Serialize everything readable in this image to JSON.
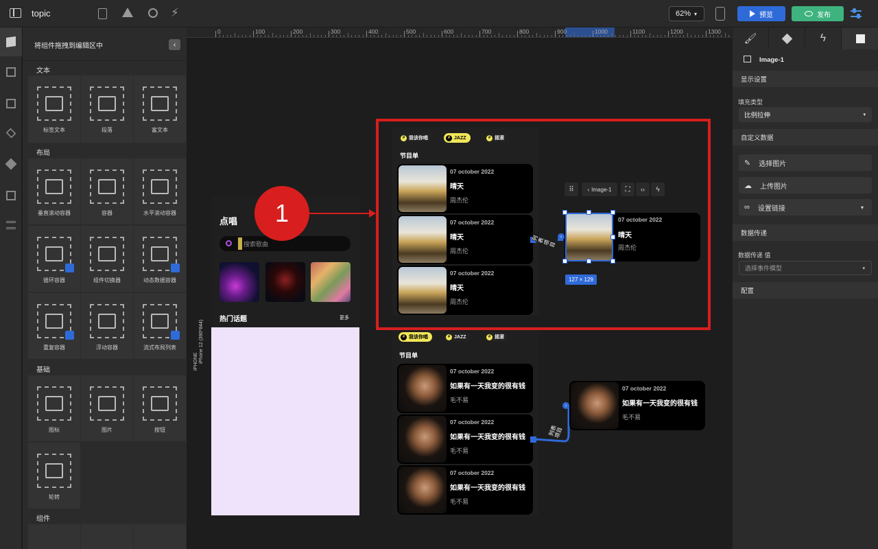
{
  "app": {
    "title": "topic"
  },
  "toolbar": {
    "zoom": "62%",
    "preview": "预览",
    "publish": "发布"
  },
  "library": {
    "header": "将组件拖拽到编辑区中",
    "sections": {
      "text": "文本",
      "layout": "布局",
      "basic": "基础",
      "components": "组件"
    },
    "text_items": [
      "标签文本",
      "段落",
      "富文本"
    ],
    "layout_items": [
      "垂直滚动容器",
      "容器",
      "水平滚动容器",
      "循环容器",
      "组件切换器",
      "动态数据容器",
      "重复容器",
      "浮动容器",
      "流式布局列表"
    ],
    "basic_items": [
      "图标",
      "图片",
      "按钮",
      "轮转"
    ]
  },
  "ruler": {
    "ticks": [
      "0",
      "100",
      "200",
      "300",
      "400",
      "500",
      "600",
      "700",
      "800",
      "900",
      "1000",
      "1100",
      "1200",
      "1300"
    ]
  },
  "phone": {
    "label": "iPHONE",
    "device": "iPhone 12 (390*844)",
    "title": "点唱",
    "search_placeholder": "搜索歌曲",
    "section_title": "热门话题",
    "more": "更多"
  },
  "annotation": {
    "number": "1"
  },
  "list_a": {
    "chips": [
      "我该你唱",
      "JAZZ",
      "摇滚"
    ],
    "active_chip": 1,
    "heading": "节目单",
    "cards": [
      {
        "date": "07 october 2022",
        "title": "晴天",
        "artist": "周杰伦"
      },
      {
        "date": "07 october 2022",
        "title": "晴天",
        "artist": "周杰伦"
      },
      {
        "date": "07 october 2022",
        "title": "晴天",
        "artist": "周杰伦"
      }
    ],
    "detail": {
      "date": "07 october 2022",
      "title": "晴天",
      "artist": "周杰伦"
    },
    "connector_label": "列表项目"
  },
  "list_b": {
    "chips": [
      "我该你唱",
      "JAZZ",
      "摇滚"
    ],
    "active_chip": 0,
    "heading": "节目单",
    "cards": [
      {
        "date": "07 october 2022",
        "title": "如果有一天我变的很有钱",
        "artist": "毛不易"
      },
      {
        "date": "07 october 2022",
        "title": "如果有一天我变的很有钱",
        "artist": "毛不易"
      },
      {
        "date": "07 october 2022",
        "title": "如果有一天我变的很有钱",
        "artist": "毛不易"
      }
    ],
    "detail": {
      "date": "07 october 2022",
      "title": "如果有一天我变的很有钱",
      "artist": "毛不易"
    },
    "connector_label": "列表项目"
  },
  "selection": {
    "name": "Image-1",
    "size": "127 × 129"
  },
  "props": {
    "element": "Image-1",
    "display_settings": "显示设置",
    "fill_type_label": "填充类型",
    "fill_type_value": "比例拉伸",
    "custom_data": "自定义数据",
    "choose_image": "选择图片",
    "upload_image": "上传图片",
    "set_link": "设置链接",
    "data_transfer": "数据传递",
    "data_transfer_value_label": "数据传递 值",
    "event_placeholder": "选择事件模型",
    "config": "配置"
  },
  "colors": {
    "accent_blue": "#2f6ad9",
    "publish_green": "#3fb37f",
    "chip_yellow": "#f1e65a",
    "annotation_red": "#d81e1e"
  }
}
